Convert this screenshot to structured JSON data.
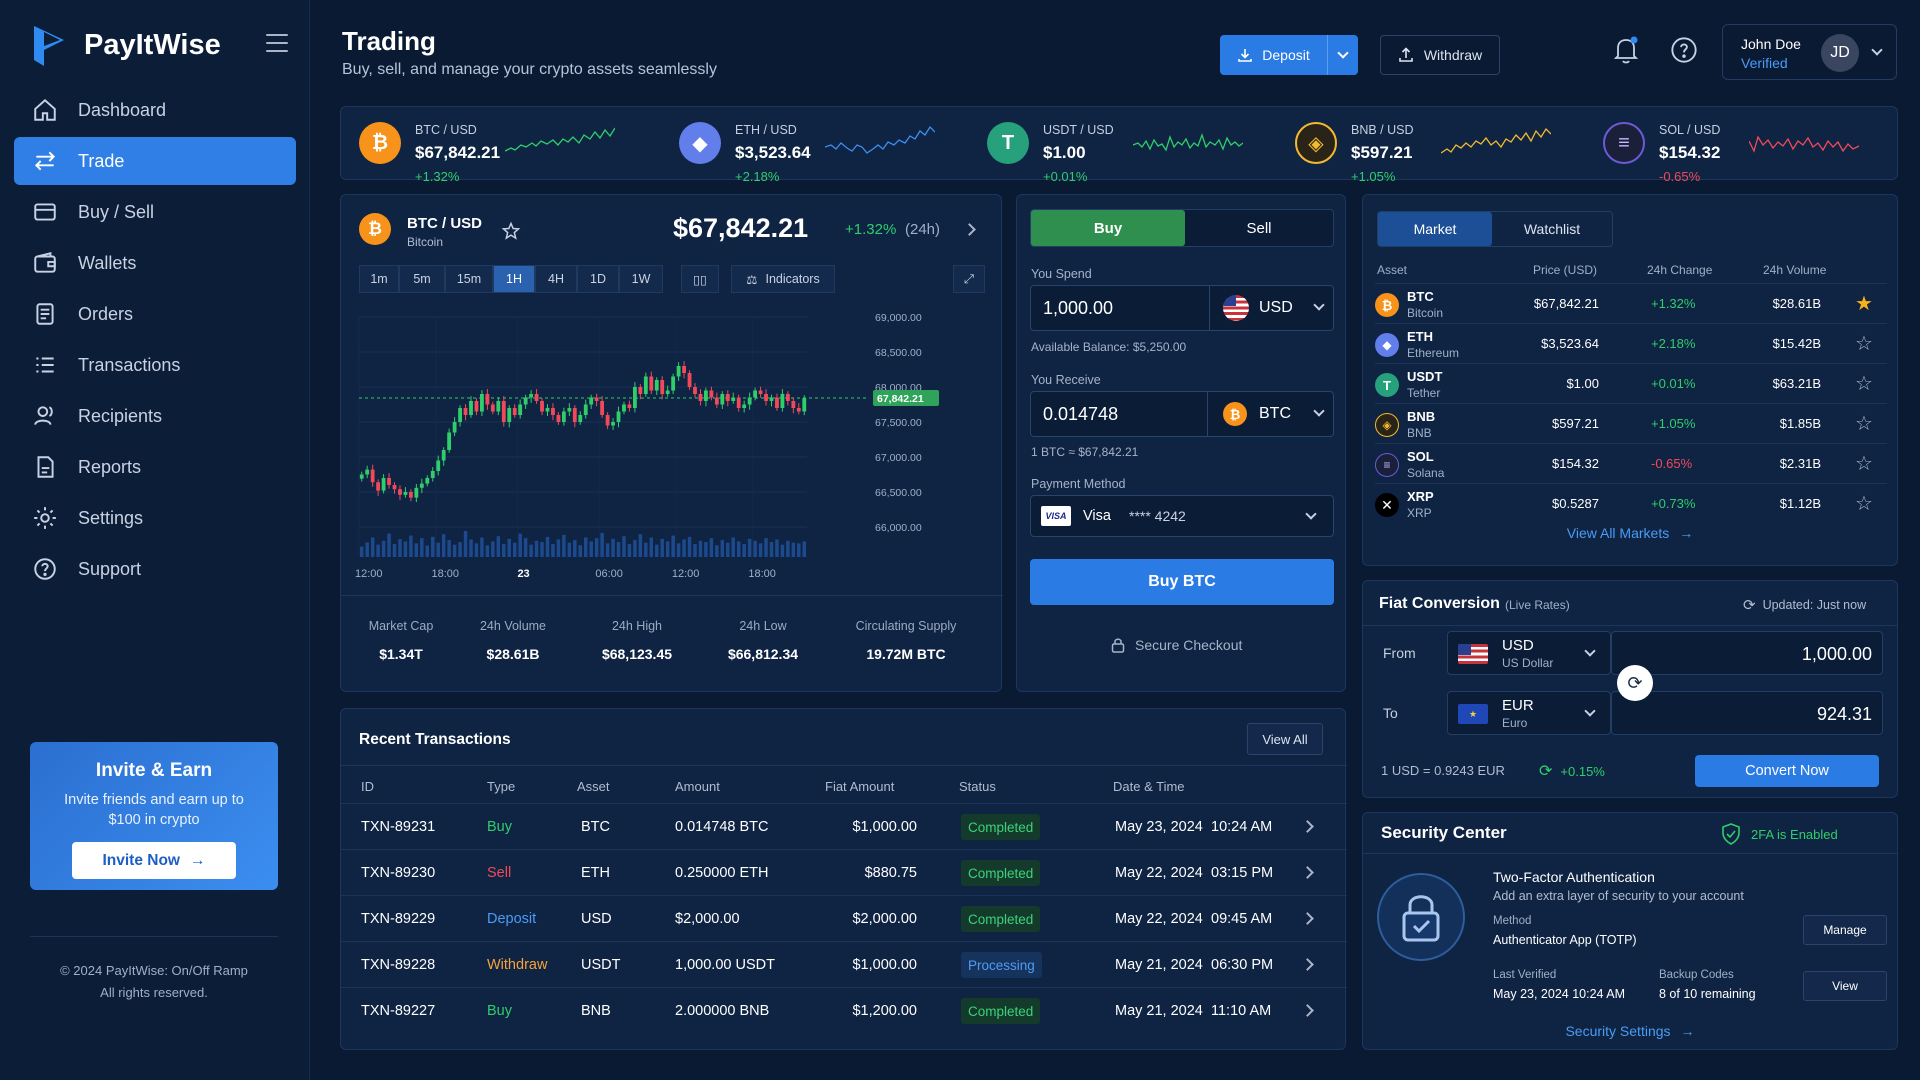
{
  "app": {
    "name": "PayItWise",
    "copyright_line1": "© 2024 PayItWise: On/Off Ramp",
    "copyright_line2": "All rights reserved."
  },
  "colors": {
    "accent": "#2f7fe6",
    "positive": "#2fce6b",
    "negative": "#f04a5a",
    "btc": "#f7931a",
    "eth": "#627eea",
    "usdt": "#26a17b",
    "bnb": "#f3ba2f",
    "sol": "#9945ff"
  },
  "sidebar": {
    "items": [
      {
        "label": "Dashboard",
        "icon": "home-icon"
      },
      {
        "label": "Trade",
        "icon": "swap-icon",
        "active": true
      },
      {
        "label": "Buy / Sell",
        "icon": "card-icon"
      },
      {
        "label": "Wallets",
        "icon": "wallet-icon"
      },
      {
        "label": "Orders",
        "icon": "document-icon"
      },
      {
        "label": "Transactions",
        "icon": "list-icon"
      },
      {
        "label": "Recipients",
        "icon": "users-icon"
      },
      {
        "label": "Reports",
        "icon": "report-icon"
      },
      {
        "label": "Settings",
        "icon": "gear-icon"
      },
      {
        "label": "Support",
        "icon": "help-icon"
      }
    ]
  },
  "invite": {
    "title": "Invite & Earn",
    "text": "Invite friends and earn up to $100 in crypto",
    "button": "Invite Now"
  },
  "header": {
    "title": "Trading",
    "subtitle": "Buy, sell, and manage your crypto assets seamlessly",
    "deposit": "Deposit",
    "withdraw": "Withdraw",
    "user_name": "John Doe",
    "user_status": "Verified",
    "user_initials": "JD"
  },
  "tickers": [
    {
      "pair": "BTC / USD",
      "price": "$67,842.21",
      "change": "+1.32%",
      "symbol": "₿"
    },
    {
      "pair": "ETH / USD",
      "price": "$3,523.64",
      "change": "+2.18%",
      "symbol": "◆"
    },
    {
      "pair": "USDT / USD",
      "price": "$1.00",
      "change": "+0.01%",
      "symbol": "T"
    },
    {
      "pair": "BNB / USD",
      "price": "$597.21",
      "change": "+1.05%",
      "symbol": "◈"
    },
    {
      "pair": "SOL / USD",
      "price": "$154.32",
      "change": "-0.65%",
      "symbol": "≡"
    }
  ],
  "chart": {
    "pair": "BTC / USD",
    "name": "Bitcoin",
    "price": "$67,842.21",
    "change": "+1.32%",
    "period": "(24h)",
    "timeframes": [
      "1m",
      "5m",
      "15m",
      "1H",
      "4H",
      "1D",
      "1W"
    ],
    "active_timeframe": "1H",
    "indicators": "Indicators",
    "current_label": "67,842.21",
    "stats": [
      {
        "label": "Market Cap",
        "value": "$1.34T"
      },
      {
        "label": "24h Volume",
        "value": "$28.61B"
      },
      {
        "label": "24h High",
        "value": "$68,123.45"
      },
      {
        "label": "24h Low",
        "value": "$66,812.34"
      },
      {
        "label": "Circulating Supply",
        "value": "19.72M BTC"
      }
    ]
  },
  "chart_data": {
    "type": "candlestick",
    "x_ticks": [
      "12:00",
      "18:00",
      "23",
      "06:00",
      "12:00",
      "18:00"
    ],
    "y_ticks": [
      "69,000.00",
      "68,500.00",
      "68,000.00",
      "67,500.00",
      "67,000.00",
      "66,500.00",
      "66,000.00"
    ],
    "ylim": [
      66000,
      69000
    ],
    "current_price": 67842.21,
    "close": [
      66750,
      66820,
      66640,
      66520,
      66700,
      66600,
      66540,
      66460,
      66500,
      66420,
      66560,
      66620,
      66700,
      66800,
      66950,
      67100,
      67350,
      67500,
      67700,
      67600,
      67800,
      67650,
      67900,
      67750,
      67650,
      67800,
      67500,
      67700,
      67600,
      67750,
      67850,
      67900,
      67800,
      67650,
      67700,
      67600,
      67500,
      67650,
      67700,
      67500,
      67600,
      67750,
      67850,
      67800,
      67600,
      67450,
      67500,
      67650,
      67750,
      67700,
      68000,
      67900,
      68150,
      67950,
      68100,
      67900,
      67950,
      68150,
      68300,
      68200,
      68000,
      67900,
      67800,
      67950,
      67850,
      67750,
      67900,
      67800,
      67850,
      67700,
      67750,
      67850,
      67950,
      67900,
      67800,
      67850,
      67700,
      67900,
      67800,
      67700,
      67650,
      67842
    ],
    "volume": [
      32,
      45,
      60,
      38,
      50,
      72,
      40,
      55,
      48,
      66,
      42,
      58,
      35,
      62,
      44,
      70,
      52,
      38,
      46,
      80,
      54,
      42,
      60,
      36,
      48,
      64,
      40,
      56,
      44,
      72,
      58,
      38,
      50,
      46,
      62,
      40,
      54,
      68,
      44,
      52,
      36,
      60,
      48,
      58,
      74,
      42,
      56,
      46,
      64,
      40,
      52,
      70,
      44,
      60,
      38,
      56,
      48,
      66,
      42,
      54,
      62,
      40,
      50,
      46,
      58,
      36,
      52,
      44,
      60,
      48,
      40,
      56,
      50,
      42,
      58,
      46,
      54,
      38,
      50,
      44,
      42,
      48
    ]
  },
  "trade": {
    "buy": "Buy",
    "sell": "Sell",
    "spend_label": "You Spend",
    "spend_value": "1,000.00",
    "spend_currency": "USD",
    "balance": "Available Balance: $5,250.00",
    "receive_label": "You Receive",
    "receive_value": "0.014748",
    "receive_currency": "BTC",
    "rate": "1 BTC ≈ $67,842.21",
    "payment_label": "Payment Method",
    "payment_brand": "VISA",
    "payment_name": "Visa",
    "payment_number": "**** 4242",
    "cta": "Buy BTC",
    "secure": "Secure Checkout"
  },
  "markets": {
    "tabs": [
      "Market",
      "Watchlist"
    ],
    "headers": [
      "Asset",
      "Price (USD)",
      "24h Change",
      "24h Volume"
    ],
    "rows": [
      {
        "symbol": "BTC",
        "name": "Bitcoin",
        "price": "$67,842.21",
        "change": "+1.32%",
        "volume": "$28.61B",
        "starred": true
      },
      {
        "symbol": "ETH",
        "name": "Ethereum",
        "price": "$3,523.64",
        "change": "+2.18%",
        "volume": "$15.42B",
        "starred": false
      },
      {
        "symbol": "USDT",
        "name": "Tether",
        "price": "$1.00",
        "change": "+0.01%",
        "volume": "$63.21B",
        "starred": false
      },
      {
        "symbol": "BNB",
        "name": "BNB",
        "price": "$597.21",
        "change": "+1.05%",
        "volume": "$1.85B",
        "starred": false
      },
      {
        "symbol": "SOL",
        "name": "Solana",
        "price": "$154.32",
        "change": "-0.65%",
        "volume": "$2.31B",
        "starred": false
      },
      {
        "symbol": "XRP",
        "name": "XRP",
        "price": "$0.5287",
        "change": "+0.73%",
        "volume": "$1.12B",
        "starred": false
      }
    ],
    "view_all": "View All Markets"
  },
  "conversion": {
    "title": "Fiat Conversion",
    "subtitle": "(Live Rates)",
    "updated": "Updated: Just now",
    "from_label": "From",
    "from_code": "USD",
    "from_name": "US Dollar",
    "from_value": "1,000.00",
    "to_label": "To",
    "to_code": "EUR",
    "to_name": "Euro",
    "to_value": "924.31",
    "rate": "1 USD = 0.9243 EUR",
    "rate_change": "+0.15%",
    "button": "Convert Now"
  },
  "security": {
    "title": "Security Center",
    "status": "2FA is Enabled",
    "tfa_title": "Two-Factor Authentication",
    "tfa_desc": "Add an extra layer of security to your account",
    "method_label": "Method",
    "method_value": "Authenticator App (TOTP)",
    "manage": "Manage",
    "verified_label": "Last Verified",
    "verified_value": "May 23, 2024 10:24 AM",
    "backup_label": "Backup Codes",
    "backup_value": "8 of 10 remaining",
    "view": "View",
    "settings_link": "Security Settings"
  },
  "transactions": {
    "title": "Recent Transactions",
    "view_all": "View All",
    "headers": [
      "ID",
      "Type",
      "Asset",
      "Amount",
      "Fiat Amount",
      "Status",
      "Date & Time"
    ],
    "rows": [
      {
        "id": "TXN-89231",
        "type": "Buy",
        "asset": "BTC",
        "amount": "0.014748 BTC",
        "fiat": "$1,000.00",
        "status": "Completed",
        "date": "May 23, 2024",
        "time": "10:24 AM"
      },
      {
        "id": "TXN-89230",
        "type": "Sell",
        "asset": "ETH",
        "amount": "0.250000 ETH",
        "fiat": "$880.75",
        "status": "Completed",
        "date": "May 22, 2024",
        "time": "03:15 PM"
      },
      {
        "id": "TXN-89229",
        "type": "Deposit",
        "asset": "USD",
        "amount": "$2,000.00",
        "fiat": "$2,000.00",
        "status": "Completed",
        "date": "May 22, 2024",
        "time": "09:45 AM"
      },
      {
        "id": "TXN-89228",
        "type": "Withdraw",
        "asset": "USDT",
        "amount": "1,000.00 USDT",
        "fiat": "$1,000.00",
        "status": "Processing",
        "date": "May 21, 2024",
        "time": "06:30 PM"
      },
      {
        "id": "TXN-89227",
        "type": "Buy",
        "asset": "BNB",
        "amount": "2.000000 BNB",
        "fiat": "$1,200.00",
        "status": "Completed",
        "date": "May 21, 2024",
        "time": "11:10 AM"
      }
    ]
  }
}
